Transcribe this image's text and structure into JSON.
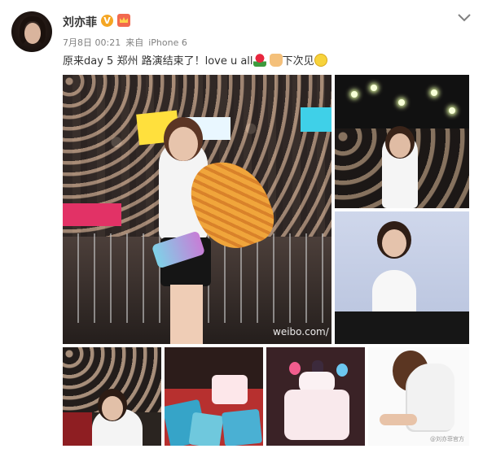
{
  "user": {
    "name": "刘亦菲",
    "verified_badge": "V",
    "vip_icon": "crown-icon"
  },
  "post": {
    "date": "7月8日 00:21",
    "source_prefix": "来自",
    "source": "iPhone 6",
    "text": "原来day 5 郑州 路演结束了！love u all",
    "text_tail": "下次见",
    "emoticons": [
      "rose-icon",
      "thumbs-up-icon",
      "shy-eyes-icon"
    ]
  },
  "images": {
    "watermark_main": "weibo.com/",
    "watermark_small": "@刘亦菲官方"
  },
  "colors": {
    "name": "#333333",
    "meta": "#808080",
    "badge": "#f5a623"
  }
}
